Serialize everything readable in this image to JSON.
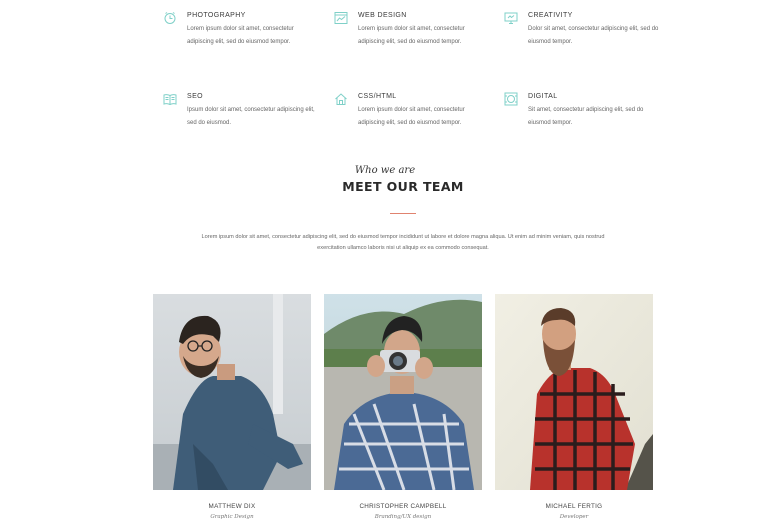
{
  "services": [
    {
      "icon": "clock-icon",
      "title": "PHOTOGRAPHY",
      "desc": "Lorem ipsum dolor sit amet, consectetur adipiscing elit, sed do eiusmod tempor."
    },
    {
      "icon": "browser-chart-icon",
      "title": "WEB DESIGN",
      "desc": "Lorem ipsum dolor sit amet, consectetur adipiscing elit, sed do eiusmod tempor."
    },
    {
      "icon": "monitor-icon",
      "title": "CREATIVITY",
      "desc": "Dolor sit amet, consectetur adipiscing elit, sed do eiusmod tempor."
    },
    {
      "icon": "book-icon",
      "title": "SEO",
      "desc": "Ipsum dolor sit amet, consectetur adipiscing elit, sed do eiusmod."
    },
    {
      "icon": "home-icon",
      "title": "CSS/HTML",
      "desc": "Lorem ipsum dolor sit amet, consectetur adipiscing elit, sed do eiusmod tempor."
    },
    {
      "icon": "grid-frame-icon",
      "title": "DIGITAL",
      "desc": "Sit amet, consectetur adipiscing elit, sed do eiusmod tempor."
    }
  ],
  "team_section": {
    "tagline": "Who we are",
    "title": "MEET OUR TEAM",
    "intro": "Lorem ipsum dolor sit amet, consectetur adipiscing elit, sed do eiusmod tempor incididunt ut labore et dolore magna aliqua. Ut enim ad minim veniam, quis nostrud exercitation ullamco laboris nisi ut aliquip ex ea commodo consequat."
  },
  "team": [
    {
      "name": "MATTHEW DIX",
      "role": "Graphic Design"
    },
    {
      "name": "CHRISTOPHER CAMPBELL",
      "role": "Branding/UX design"
    },
    {
      "name": "MICHAEL FERTIG",
      "role": "Developer"
    }
  ],
  "colors": {
    "accent": "#7fd0c8",
    "divider": "#e0836f"
  }
}
